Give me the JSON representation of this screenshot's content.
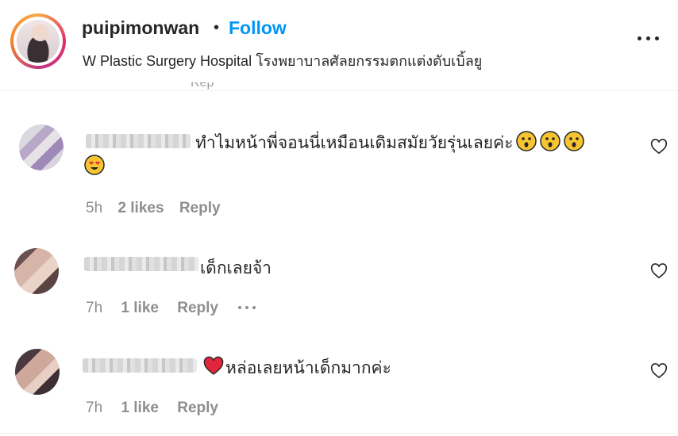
{
  "header": {
    "username": "puipimonwan",
    "separator": "•",
    "follow_label": "Follow",
    "location": "W Plastic Surgery Hospital โรงพยาบาลศัลยกรรมตกแต่งดับเบิ้ลยู",
    "more_icon": "more-horizontal-icon"
  },
  "comments": [
    {
      "text": "ทำไมหน้าพี่จอนนี่เหมือนเดิมสมัยวัยรุ่นเลยค่ะ",
      "emojis": [
        "hushed-face",
        "hushed-face",
        "hushed-face",
        "heart-eyes"
      ],
      "time": "5h",
      "likes": "2 likes",
      "reply": "Reply"
    },
    {
      "text": "เด็กเลยจ้า",
      "time": "7h",
      "likes": "1 like",
      "reply": "Reply"
    },
    {
      "text": "หล่อเลยหน้าเด็กมากค่ะ",
      "emojis": [
        "red-heart"
      ],
      "time": "7h",
      "likes": "1 like",
      "reply": "Reply"
    }
  ],
  "colors": {
    "follow_blue": "#0095f6",
    "meta_gray": "#8e8e8e",
    "text": "#262626"
  }
}
